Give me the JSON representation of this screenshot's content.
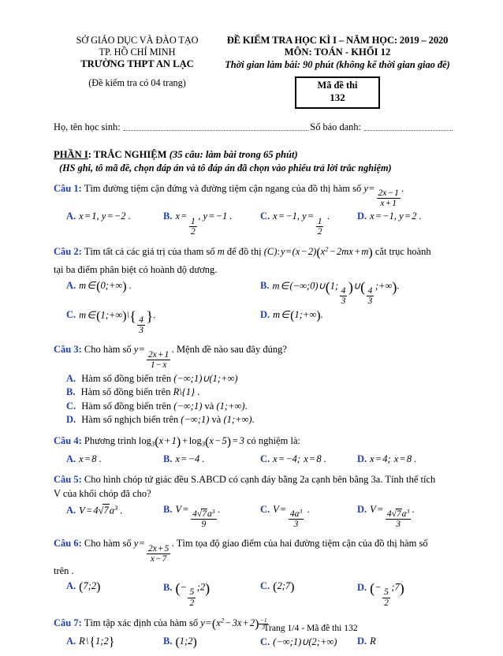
{
  "header": {
    "left": {
      "line1": "SỞ GIÁO DỤC VÀ ĐÀO TẠO",
      "line2": "TP. HỒ CHÍ MINH",
      "line3": "TRƯỜNG THPT AN LẠC",
      "note": "(Đề kiểm tra có 04 trang)"
    },
    "right": {
      "line1": "ĐỀ KIỂM TRA HỌC KÌ I – NĂM HỌC: 2019 – 2020",
      "line2": "MÔN: TOÁN  - KHỐI 12",
      "line3": "Thời gian làm bài: 90 phút (không kể thời gian giao đề)"
    },
    "code_box": {
      "title": "Mã đề thi",
      "value": "132"
    }
  },
  "student_row": {
    "name_label": "Họ, tên học sinh:",
    "id_label": "Số báo danh:"
  },
  "section": {
    "part_label": "PHẦN I",
    "part_title": ": TRẮC NGHIỆM",
    "part_detail": "(35 câu: làm bài trong 65 phút)",
    "instruction": "(HS ghi, tô mã đề, chọn đáp án và tô đáp án đã chọn vào phiếu trả lời trắc nghiệm)"
  },
  "questions": [
    {
      "label": "Câu 1:",
      "stem": "Tìm đường tiệm cận đứng và đường tiệm cận ngang của đồ thị hàm số",
      "options": {
        "a": "A.",
        "b": "B.",
        "c": "C.",
        "d": "D."
      },
      "opt_a_text": "x = 1, y = −2.",
      "opt_b_text": "x = 1/2, y = −1.",
      "opt_c_text": "x = −1, y = 1/2.",
      "opt_d_text": "x = −1, y = 2."
    },
    {
      "label": "Câu 2:",
      "stem_1": "Tìm tất cả các giá trị của tham số",
      "stem_2": "để đồ thị",
      "stem_3": "cắt trục hoành",
      "stem_line2": "tại ba điểm phân biệt có hoành độ dương.",
      "opt_a_text": "m ∈ (0;+∞).",
      "opt_b_text": "m ∈ (−∞;0) ∪ (1;4/3) ∪ (4/3;+∞).",
      "opt_c_text": "m ∈ (1;+∞) \\ {4/3}.",
      "opt_d_text": "m ∈ (1;+∞)."
    },
    {
      "label": "Câu 3:",
      "stem_1": "Cho hàm số",
      "stem_2": ". Mệnh đề nào sau đây đúng?",
      "opt_a_text": "Hàm số đồng biến trên (−∞;1)∪(1;+∞)",
      "opt_b_text": "Hàm số đồng biến trên R\\{1}.",
      "opt_c_text": "Hàm số đồng biến trên (−∞;1) và (1;+∞).",
      "opt_d_text": "Hàm số nghịch biến trên (−∞;1) và (1;+∞)."
    },
    {
      "label": "Câu 4:",
      "stem_1": "Phương trình",
      "stem_2": "có nghiệm là:",
      "opt_a_text": "x = 8.",
      "opt_b_text": "x = −4.",
      "opt_c_text": "x = −4; x = 8.",
      "opt_d_text": "x = 4; x = 8."
    },
    {
      "label": "Câu 5:",
      "stem_line1": "Cho hình chóp tứ giác đều S.ABCD có cạnh đáy bằng 2a cạnh bên bằng 3a. Tính thể tích",
      "stem_line2": "V của khối chóp đã cho?",
      "opt_a_text": "V = 4√7 a³.",
      "opt_b_text": "V = 4√7 a³ / 9.",
      "opt_c_text": "V = 4a³ / 3.",
      "opt_d_text": "V = 4√7 a³ / 3."
    },
    {
      "label": "Câu 6:",
      "stem_1": "Cho hàm số",
      "stem_2": ". Tìm tọa độ giao điểm của hai đường tiệm cận của đồ thị hàm số",
      "stem_line2": "trên .",
      "opt_a_text": "(7;2)",
      "opt_b_text": "(−5/2;2)",
      "opt_c_text": "(2;7)",
      "opt_d_text": "(−5/2;7)"
    },
    {
      "label": "Câu 7:",
      "stem_1": "Tìm tập xác định của hàm số",
      "opt_a_text": "R\\{1;2}",
      "opt_b_text": "(1;2)",
      "opt_c_text": "(−∞;1)∪(2;+∞)",
      "opt_d_text": "R"
    }
  ],
  "option_letters": {
    "a": "A.",
    "b": "B.",
    "c": "C.",
    "d": "D."
  },
  "footer": "Trang 1/4 - Mã đề thi 132"
}
